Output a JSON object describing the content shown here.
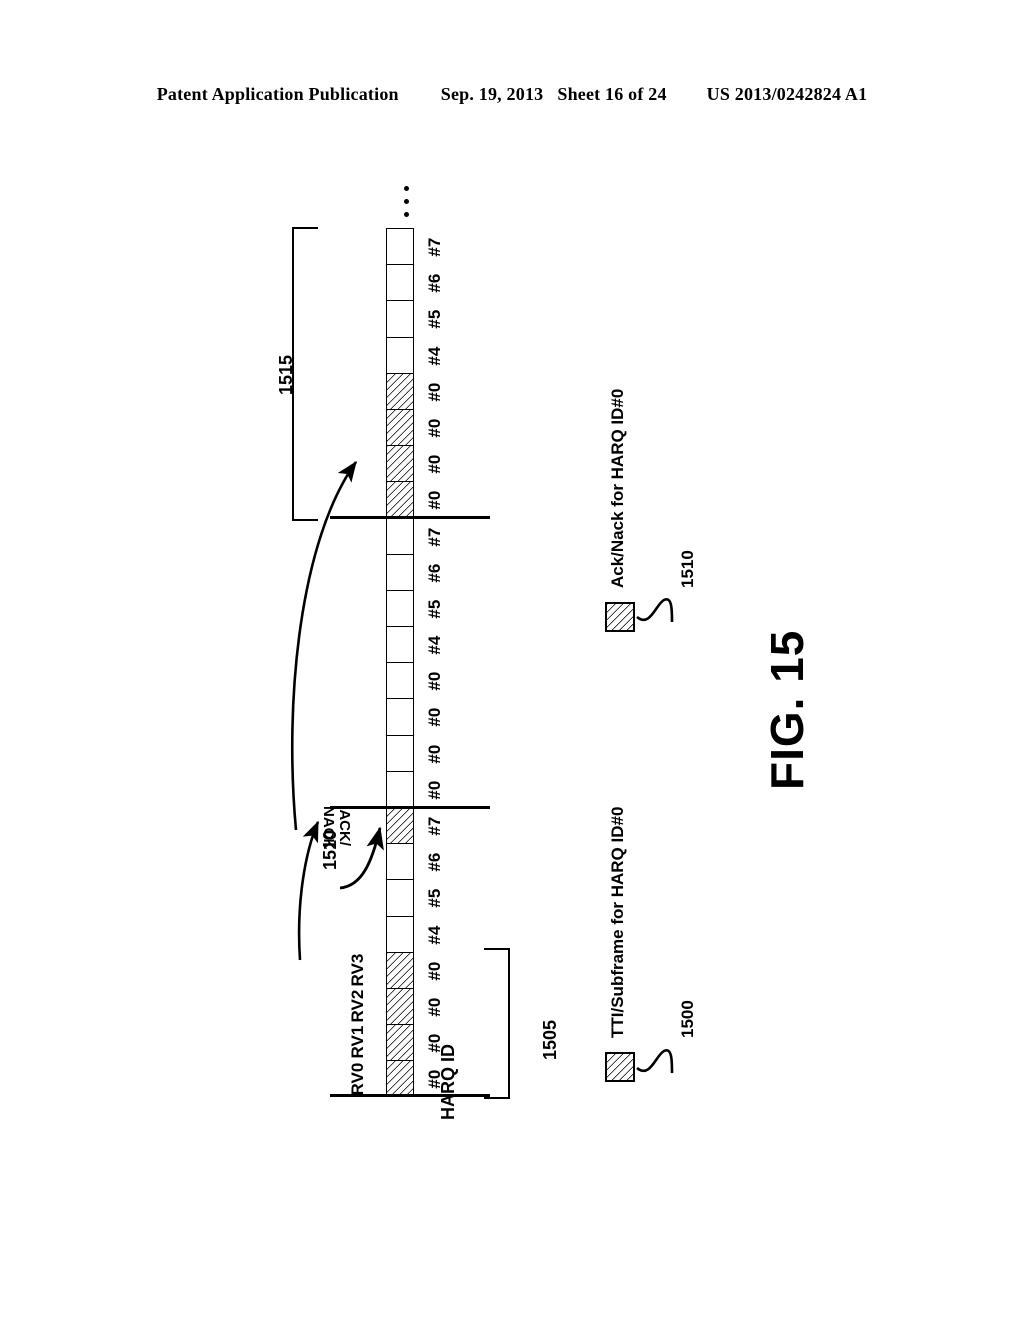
{
  "header": {
    "publication": "Patent Application Publication",
    "date": "Sep. 19, 2013",
    "sheet": "Sheet 16 of 24",
    "number": "US 2013/0242824 A1"
  },
  "figure": {
    "caption": "FIG. 15",
    "axis_caption": "HARQ ID",
    "ellipsis": "⋮",
    "callout_acknack_line1": "ACK/",
    "callout_acknack_line2": "NACK",
    "callout_acknack_ref": "1510",
    "bracket_upper_ref": "1515",
    "bracket_lower_ref": "1505"
  },
  "rv_labels": [
    "RV3",
    "RV2",
    "RV1",
    "RV0"
  ],
  "cells": [
    {
      "id": "#7",
      "hatched": false
    },
    {
      "id": "#6",
      "hatched": false
    },
    {
      "id": "#5",
      "hatched": false
    },
    {
      "id": "#4",
      "hatched": false
    },
    {
      "id": "#0",
      "hatched": true
    },
    {
      "id": "#0",
      "hatched": true
    },
    {
      "id": "#0",
      "hatched": true
    },
    {
      "id": "#0",
      "hatched": true
    },
    {
      "id": "#7",
      "hatched": false
    },
    {
      "id": "#6",
      "hatched": false
    },
    {
      "id": "#5",
      "hatched": false
    },
    {
      "id": "#4",
      "hatched": false
    },
    {
      "id": "#0",
      "hatched": false
    },
    {
      "id": "#0",
      "hatched": false
    },
    {
      "id": "#0",
      "hatched": false
    },
    {
      "id": "#0",
      "hatched": false
    },
    {
      "id": "#7",
      "hatched": true
    },
    {
      "id": "#6",
      "hatched": false
    },
    {
      "id": "#5",
      "hatched": false
    },
    {
      "id": "#4",
      "hatched": false
    },
    {
      "id": "#0",
      "hatched": true
    },
    {
      "id": "#0",
      "hatched": true
    },
    {
      "id": "#0",
      "hatched": true
    },
    {
      "id": "#0",
      "hatched": true
    }
  ],
  "legend": [
    {
      "label": "Ack/Nack for HARQ ID#0",
      "ref": "1510"
    },
    {
      "label": "TTI/Subframe for HARQ ID#0",
      "ref": "1500"
    }
  ],
  "colors": {
    "ink": "#000000",
    "paper": "#ffffff"
  }
}
